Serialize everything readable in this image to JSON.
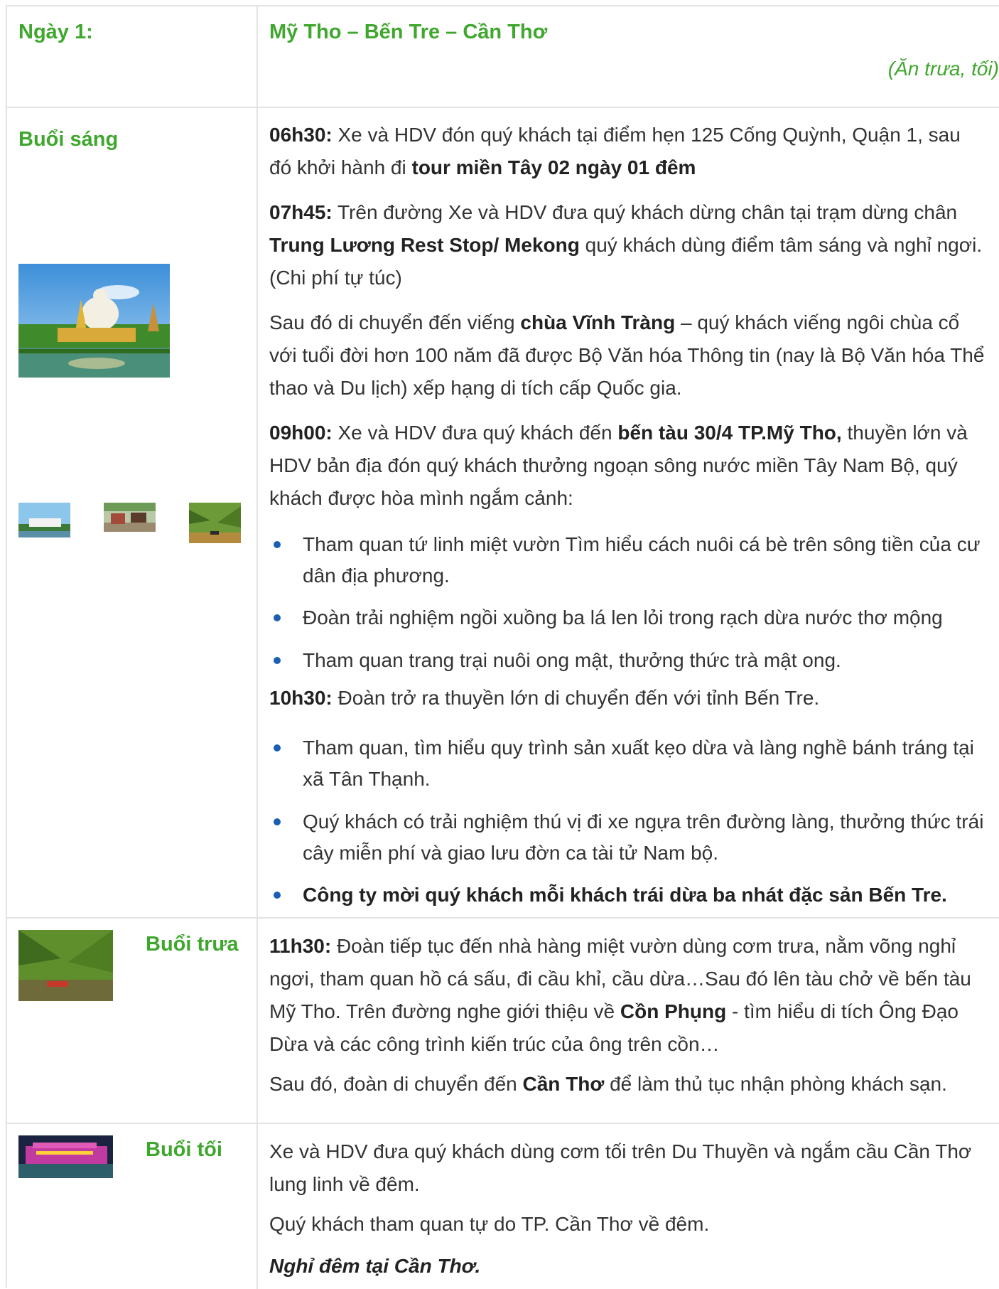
{
  "day": {
    "label": "Ngày 1:",
    "route": "Mỹ Tho – Bến Tre – Cần Thơ",
    "meals": "(Ăn trưa, tối)"
  },
  "morning": {
    "label": "Buổi sáng",
    "p1_time": "06h30:",
    "p1_text": " Xe và HDV đón quý khách tại điểm hẹn 125 Cống Quỳnh, Quận 1, sau đó khởi hành đi ",
    "p1_bold": "tour miền Tây 02 ngày 01 đêm",
    "p2_time": "07h45:",
    "p2_text": "  Trên đường Xe và HDV đưa quý khách dừng chân tại trạm dừng chân ",
    "p2_bold": "Trung Lương Rest Stop/ Mekong",
    "p2_text2": " quý khách dùng điểm tâm sáng và nghỉ ngơi. (Chi phí tự túc)",
    "p3_text": "Sau đó di chuyển đến viếng ",
    "p3_bold": "chùa Vĩnh Tràng",
    "p3_text2": " – quý khách viếng ngôi chùa cổ với tuổi đời hơn 100 năm đã được Bộ Văn hóa Thông tin (nay là Bộ Văn hóa Thể thao và Du lịch) xếp hạng di tích cấp Quốc gia.",
    "p4_time": "09h00:",
    "p4_text": " Xe và HDV đưa quý khách đến ",
    "p4_bold": "bến tàu 30/4 TP.Mỹ Tho,",
    "p4_text2": " thuyền lớn và HDV bản địa đón quý khách thưởng ngoạn sông nước miền Tây Nam Bộ, quý khách được hòa mình ngắm cảnh:",
    "bullets1": [
      "Tham quan tứ linh miệt vườn Tìm hiểu cách nuôi cá bè trên sông tiền của cư dân địa phương.",
      "Đoàn trải nghiệm ngồi xuồng ba lá len lỏi trong rạch dừa nước thơ mộng",
      "Tham quan trang trại nuôi ong mật, thưởng thức trà mật ong."
    ],
    "p5_time": "10h30:",
    "p5_text": " Đoàn trở ra thuyền lớn di chuyển đến với tỉnh Bến Tre.",
    "bullets2": [
      "Tham quan, tìm hiểu quy trình sản xuất kẹo dừa và làng nghề bánh tráng tại xã Tân Thạnh.",
      "Quý khách có trải nghiệm thú vị đi xe ngựa trên đường làng, thưởng thức trái cây miễn phí và giao lưu đờn ca tài tử Nam bộ."
    ],
    "bullet_bold": "Công ty mời quý khách mỗi khách trái dừa ba nhát đặc sản Bến Tre."
  },
  "noon": {
    "label": "Buổi trưa",
    "p1_time": "11h30:",
    "p1_text": " Đoàn tiếp tục đến nhà hàng miệt vườn dùng cơm trưa, nằm võng nghỉ ngơi, tham quan hồ cá sấu, đi cầu khỉ, cầu dừa…Sau đó lên tàu chở về bến tàu Mỹ Tho. Trên đường nghe giới thiệu về ",
    "p1_bold": "Cồn Phụng",
    "p1_text2": " - tìm hiểu di tích Ông Đạo Dừa và các công trình kiến trúc của ông trên cồn…",
    "p2_text": "Sau đó, đoàn di chuyển đến ",
    "p2_bold": "Cần Thơ",
    "p2_text2": " để làm thủ tục nhận phòng khách sạn."
  },
  "evening": {
    "label": "Buổi tối",
    "p1": "Xe và HDV đưa quý khách dùng cơm tối trên Du Thuyền và ngắm cầu Cần Thơ lung linh về đêm.",
    "p2": "Quý khách tham quan tự do TP. Cần Thơ về đêm.",
    "p3": "Nghỉ đêm tại Cần Thơ."
  },
  "colors": {
    "accent": "#3fa72d",
    "bullet": "#1a5fb4",
    "border": "#e3e3e3"
  }
}
